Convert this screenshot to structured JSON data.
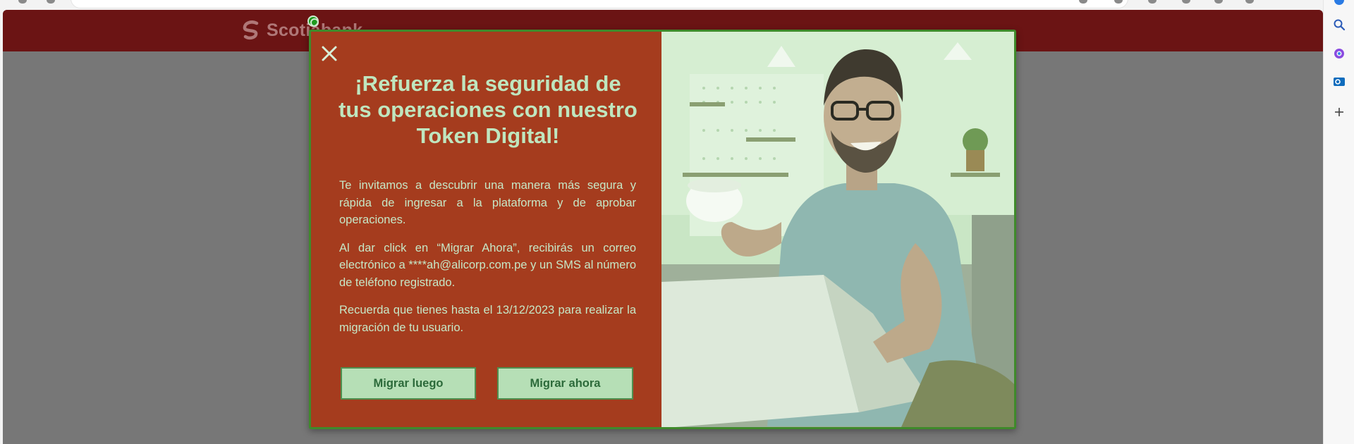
{
  "site": {
    "logo_text": "Scotiabank"
  },
  "modal": {
    "title": "¡Refuerza la seguridad de tus operaciones con nuestro Token Digital!",
    "paragraphs": [
      "Te invitamos a descubrir una manera más segura y rápida de ingresar a la plataforma y de aprobar operaciones.",
      "Al dar click en “Migrar Ahora”, recibirás un correo electrónico a ****ah@alicorp.com.pe y un SMS al número de teléfono registrado.",
      "Recuerda que tienes hasta el 13/12/2023 para realizar la migración de tu usuario."
    ],
    "buttons": {
      "later_label": "Migrar luego",
      "now_label": "Migrar ahora"
    }
  },
  "sidebar_icons": [
    "search-icon",
    "copilot-icon",
    "outlook-icon",
    "add-icon"
  ],
  "colors": {
    "header": "#6b1414",
    "modal_bg": "#a53c1e",
    "modal_border": "#3f8a2b",
    "button_bg": "#b6dfb6",
    "text_tint": "#bfe6bf",
    "backdrop": "#777777"
  }
}
